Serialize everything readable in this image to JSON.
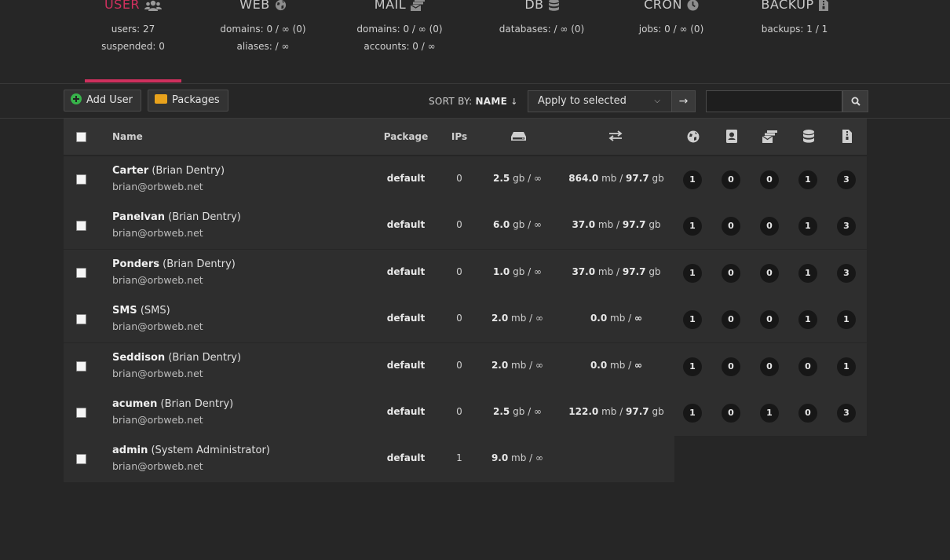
{
  "stats": {
    "user": {
      "title": "USER",
      "lines": [
        "users: 27",
        "suspended: 0"
      ]
    },
    "web": {
      "title": "WEB",
      "lines": [
        "domains: 0 / ∞ (0)",
        "aliases: / ∞"
      ]
    },
    "mail": {
      "title": "MAIL",
      "lines": [
        "domains: 0 / ∞ (0)",
        "accounts: 0 / ∞"
      ]
    },
    "db": {
      "title": "DB",
      "lines": [
        "databases: / ∞ (0)"
      ]
    },
    "cron": {
      "title": "CRON",
      "lines": [
        "jobs: 0 / ∞ (0)"
      ]
    },
    "backup": {
      "title": "BACKUP",
      "lines": [
        "backups: 1 / 1"
      ]
    }
  },
  "toolbar": {
    "add_user": "Add User",
    "packages": "Packages",
    "sort_label": "SORT BY:",
    "sort_value": "NAME",
    "bulk_action": "Apply to selected",
    "search_placeholder": ""
  },
  "table": {
    "headers": {
      "name": "Name",
      "package": "Package",
      "ips": "IPs"
    },
    "rows": [
      {
        "user": "Carter",
        "full": "(Brian Dentry)",
        "email": "brian@orbweb.net",
        "package": "default",
        "ips": "0",
        "disk_v": "2.5",
        "disk_u": "gb",
        "disk_q": "∞",
        "bw_v": "864.0",
        "bw_u": "mb",
        "bw_q": "97.7",
        "bw_qu": "gb",
        "web": "1",
        "dns": "0",
        "mail": "0",
        "db": "1",
        "backup": "3"
      },
      {
        "user": "Panelvan",
        "full": "(Brian Dentry)",
        "email": "brian@orbweb.net",
        "package": "default",
        "ips": "0",
        "disk_v": "6.0",
        "disk_u": "gb",
        "disk_q": "∞",
        "bw_v": "37.0",
        "bw_u": "mb",
        "bw_q": "97.7",
        "bw_qu": "gb",
        "web": "1",
        "dns": "0",
        "mail": "0",
        "db": "1",
        "backup": "3"
      },
      {
        "user": "Ponders",
        "full": "(Brian Dentry)",
        "email": "brian@orbweb.net",
        "package": "default",
        "ips": "0",
        "disk_v": "1.0",
        "disk_u": "gb",
        "disk_q": "∞",
        "bw_v": "37.0",
        "bw_u": "mb",
        "bw_q": "97.7",
        "bw_qu": "gb",
        "web": "1",
        "dns": "0",
        "mail": "0",
        "db": "1",
        "backup": "3"
      },
      {
        "user": "SMS",
        "full": "(SMS)",
        "email": "brian@orbweb.net",
        "package": "default",
        "ips": "0",
        "disk_v": "2.0",
        "disk_u": "mb",
        "disk_q": "∞",
        "bw_v": "0.0",
        "bw_u": "mb",
        "bw_q": "∞",
        "bw_qu": "",
        "web": "1",
        "dns": "0",
        "mail": "0",
        "db": "1",
        "backup": "1"
      },
      {
        "user": "Seddison",
        "full": "(Brian Dentry)",
        "email": "brian@orbweb.net",
        "package": "default",
        "ips": "0",
        "disk_v": "2.0",
        "disk_u": "mb",
        "disk_q": "∞",
        "bw_v": "0.0",
        "bw_u": "mb",
        "bw_q": "∞",
        "bw_qu": "",
        "web": "1",
        "dns": "0",
        "mail": "0",
        "db": "0",
        "backup": "1"
      },
      {
        "user": "acumen",
        "full": "(Brian Dentry)",
        "email": "brian@orbweb.net",
        "package": "default",
        "ips": "0",
        "disk_v": "2.5",
        "disk_u": "gb",
        "disk_q": "∞",
        "bw_v": "122.0",
        "bw_u": "mb",
        "bw_q": "97.7",
        "bw_qu": "gb",
        "web": "1",
        "dns": "0",
        "mail": "1",
        "db": "0",
        "backup": "3"
      },
      {
        "user": "admin",
        "full": "(System Administrator)",
        "email": "brian@orbweb.net",
        "package": "default",
        "ips": "1",
        "disk_v": "9.0",
        "disk_u": "mb",
        "disk_q": "∞"
      }
    ]
  },
  "colors": {
    "accent": "#d0305e",
    "background": "#262626",
    "row": "#2e2e2e",
    "header": "#333333"
  },
  "icons": {
    "disk": "hdd-icon",
    "bandwidth": "exchange-icon",
    "web": "globe-icon",
    "dns": "address-book-icon",
    "mail": "mail-stack-icon",
    "db": "database-icon",
    "backup": "file-archive-icon"
  }
}
